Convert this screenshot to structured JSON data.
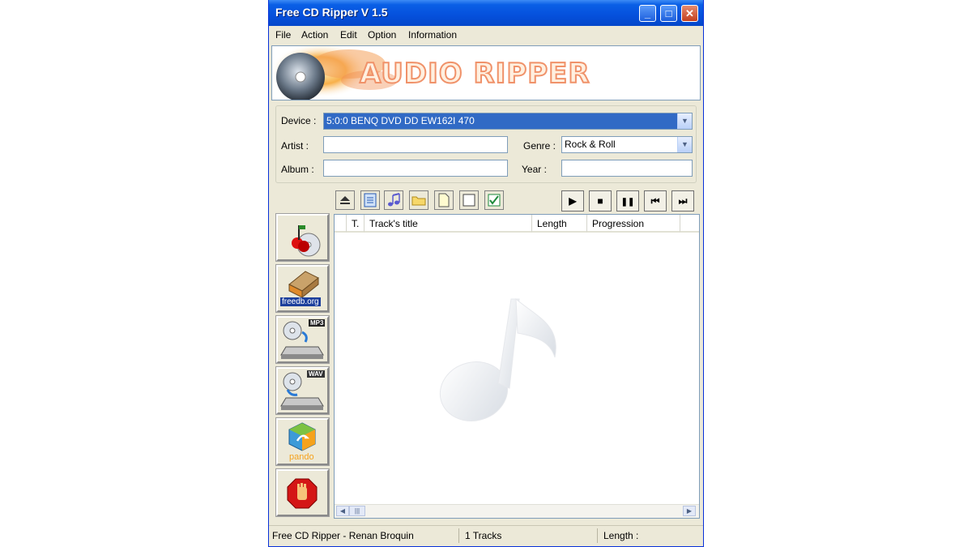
{
  "window": {
    "title": "Free CD Ripper V 1.5"
  },
  "title_buttons": {
    "minimize": "_",
    "maximize": "□",
    "close": "✕"
  },
  "menu": [
    "File",
    "Action",
    "Edit",
    "Option",
    "Information"
  ],
  "banner": {
    "text": "AUDIO RIPPER"
  },
  "form": {
    "device_label": "Device :",
    "device_value": "5:0:0 BENQ    DVD DD EW162I   470",
    "artist_label": "Artist :",
    "artist_value": "",
    "album_label": "Album :",
    "album_value": "",
    "genre_label": "Genre :",
    "genre_value": "Rock & Roll",
    "year_label": "Year :",
    "year_value": ""
  },
  "toolbar_icons": [
    "eject-icon",
    "notepad-icon",
    "music-note-icon",
    "folder-icon",
    "new-document-icon",
    "select-none-icon",
    "select-all-icon"
  ],
  "playback_icons": [
    "play-icon",
    "stop-icon",
    "pause-icon",
    "previous-track-icon",
    "next-track-icon"
  ],
  "playback_glyphs": {
    "play": "▶",
    "stop": "■",
    "pause": "❚❚",
    "prev": "⏮",
    "next": "⏭"
  },
  "side_buttons": {
    "freedb_label": "freedb.org",
    "mp3_badge": "MP3",
    "wav_badge": "WAV",
    "pando_label": "pando"
  },
  "track_list": {
    "columns": [
      "T.",
      "Track's title",
      "Length",
      "Progression"
    ],
    "rows": []
  },
  "status": {
    "author": "Free CD Ripper - Renan Broquin",
    "tracks": "1 Tracks",
    "length": "Length :"
  },
  "colors": {
    "title_bar": "#0550dc",
    "selection": "#316ac5",
    "window_bg": "#ece9d8"
  }
}
